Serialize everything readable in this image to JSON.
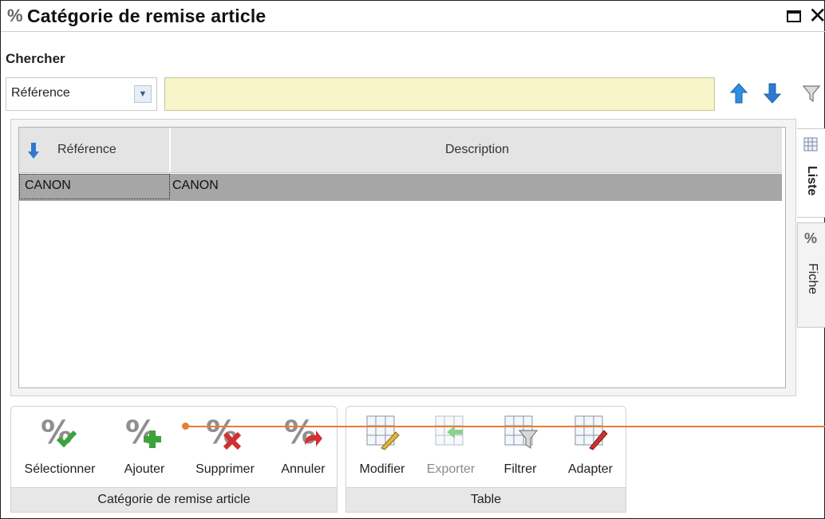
{
  "window": {
    "title": "Catégorie de remise article"
  },
  "search": {
    "label": "Chercher",
    "field_selected": "Référence",
    "value": ""
  },
  "grid": {
    "columns": [
      "Référence",
      "Description"
    ],
    "rows": [
      {
        "reference": "CANON",
        "description": "CANON"
      }
    ]
  },
  "side_tabs": {
    "liste": "Liste",
    "fiche": "Fiche"
  },
  "ribbon": {
    "group1": {
      "title": "Catégorie de remise article",
      "buttons": [
        "Sélectionner",
        "Ajouter",
        "Supprimer",
        "Annuler"
      ]
    },
    "group2": {
      "title": "Table",
      "buttons": [
        "Modifier",
        "Exporter",
        "Filtrer",
        "Adapter"
      ]
    }
  },
  "icons": {
    "title": "percent-icon",
    "sort_up": "arrow-up-icon",
    "sort_down": "arrow-down-icon",
    "filter": "funnel-icon",
    "column_sort": "sort-down-icon"
  },
  "colors": {
    "search_field": "#f6f4c8",
    "selected_row": "#a6a6a6",
    "accent_blue": "#2f78d0",
    "annotation_line": "#e87d36"
  }
}
